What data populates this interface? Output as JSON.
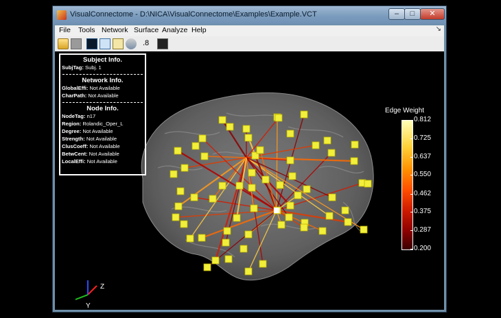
{
  "window": {
    "title": "VisualConnectome - D:\\NICA\\VisualConnectome\\Examples\\Example.VCT",
    "controls": {
      "minimize": "–",
      "maximize": "□",
      "close": "✕"
    }
  },
  "menubar": [
    "File",
    "Tools",
    "Network",
    "Surface",
    "Analyze",
    "Help"
  ],
  "menubar_pin": "↘",
  "toolbar": {
    "icons": [
      "folder-open-icon",
      "save-icon",
      "view-mode-icon",
      "view-panel-icon",
      "copy-icon",
      "settings-icon",
      "snapshot-icon"
    ],
    "value": ".8"
  },
  "info": {
    "subject": {
      "title": "Subject Info.",
      "rows": [
        {
          "label": "SubjTag:",
          "value": "Subj. 1"
        }
      ]
    },
    "network": {
      "title": "Network Info.",
      "rows": [
        {
          "label": "GlobalEffi:",
          "value": "Not Available"
        },
        {
          "label": "CharPath:",
          "value": "Not Available"
        }
      ]
    },
    "node": {
      "title": "Node Info.",
      "rows": [
        {
          "label": "NodeTag:",
          "value": "n17"
        },
        {
          "label": "Region:",
          "value": "Rolandic_Oper_L"
        },
        {
          "label": "Degree:",
          "value": "Not Available"
        },
        {
          "label": "Strength:",
          "value": "Not Available"
        },
        {
          "label": "ClusCoeff:",
          "value": "Not Available"
        },
        {
          "label": "BetwCent:",
          "value": "Not Available"
        },
        {
          "label": "LocalEffi:",
          "value": "Not Available"
        }
      ]
    }
  },
  "colorbar": {
    "title": "Edge Weight",
    "ticks": [
      "0.812",
      "0.725",
      "0.637",
      "0.550",
      "0.462",
      "0.375",
      "0.287",
      "0.200"
    ]
  },
  "axes": {
    "z": "Z",
    "y": "Y"
  }
}
